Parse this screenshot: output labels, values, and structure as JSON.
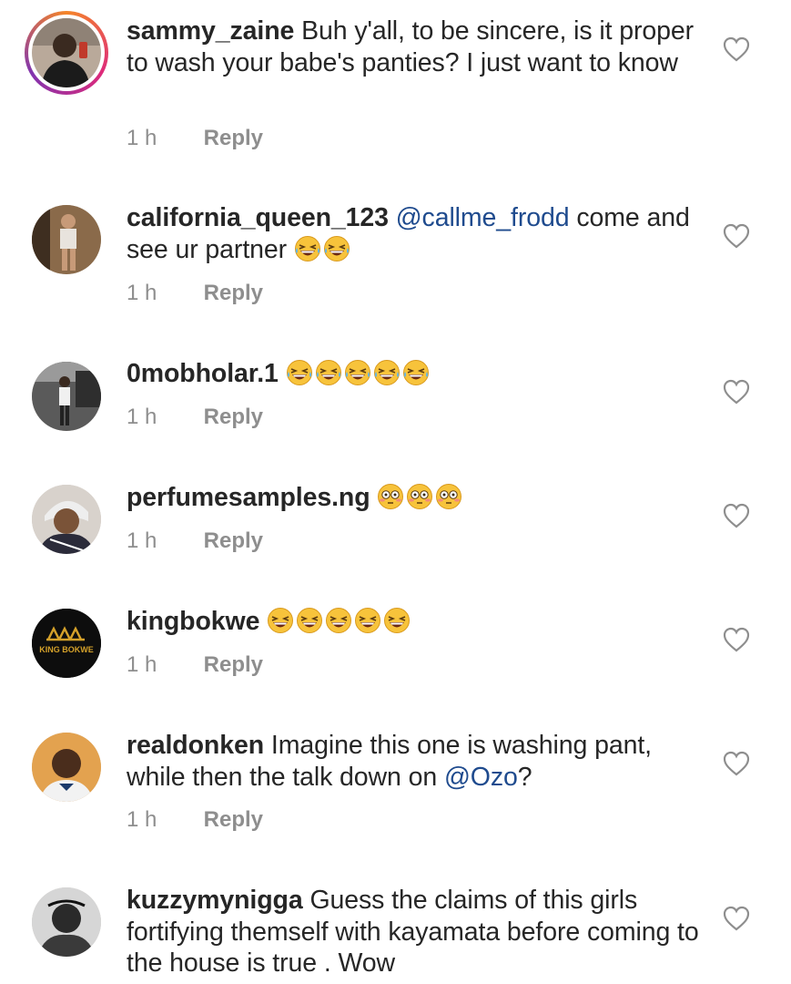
{
  "comments": [
    {
      "username": "sammy_zaine",
      "text_before": "Buh y'all, to be sincere, is it proper to wash your babe's panties? I just want to know",
      "mention": "",
      "text_after": "",
      "emoji": "",
      "emoji_count": 0,
      "time": "1 h",
      "reply": "Reply",
      "avatar_icon": "user-photo-avatar",
      "has_story_ring": true
    },
    {
      "username": "california_queen_123",
      "text_before": "",
      "mention": "@callme_frodd",
      "text_after": "come and see ur partner",
      "emoji": "rolling-on-floor-laughing",
      "emoji_count": 2,
      "time": "1 h",
      "reply": "Reply",
      "avatar_icon": "user-photo-avatar",
      "has_story_ring": false
    },
    {
      "username": "0mobholar.1",
      "text_before": "",
      "mention": "",
      "text_after": "",
      "emoji": "rolling-on-floor-laughing",
      "emoji_count": 5,
      "time": "1 h",
      "reply": "Reply",
      "avatar_icon": "user-photo-avatar",
      "has_story_ring": false
    },
    {
      "username": "perfumesamples.ng",
      "text_before": "",
      "mention": "",
      "text_after": "",
      "emoji": "flushed-face",
      "emoji_count": 3,
      "time": "1 h",
      "reply": "Reply",
      "avatar_icon": "user-photo-avatar",
      "has_story_ring": false
    },
    {
      "username": "kingbokwe",
      "text_before": "",
      "mention": "",
      "text_after": "",
      "emoji": "grinning-squinting-face",
      "emoji_count": 5,
      "time": "1 h",
      "reply": "Reply",
      "avatar_icon": "king-bokwe-logo",
      "avatar_logo_text": "KING BOKWE",
      "has_story_ring": false
    },
    {
      "username": "realdonken",
      "text_before": "Imagine this one is washing pant, while then the talk down on",
      "mention": "@Ozo",
      "text_after": "?",
      "emoji": "",
      "emoji_count": 0,
      "time": "1 h",
      "reply": "Reply",
      "avatar_icon": "user-photo-avatar",
      "has_story_ring": false
    },
    {
      "username": "kuzzymynigga",
      "text_before": "Guess the claims of this girls fortifying themself with kayamata before coming to the house is true . Wow",
      "mention": "",
      "text_after": "",
      "emoji": "",
      "emoji_count": 0,
      "time": "",
      "reply": "",
      "avatar_icon": "user-photo-avatar",
      "has_story_ring": false
    }
  ],
  "colors": {
    "username": "#262626",
    "mention": "#1f4b8e",
    "meta": "#8e8e8e",
    "story_ring": [
      "#f58529",
      "#dd2a7b",
      "#8134af"
    ]
  },
  "icons": {
    "like": "heart-outline-icon"
  }
}
